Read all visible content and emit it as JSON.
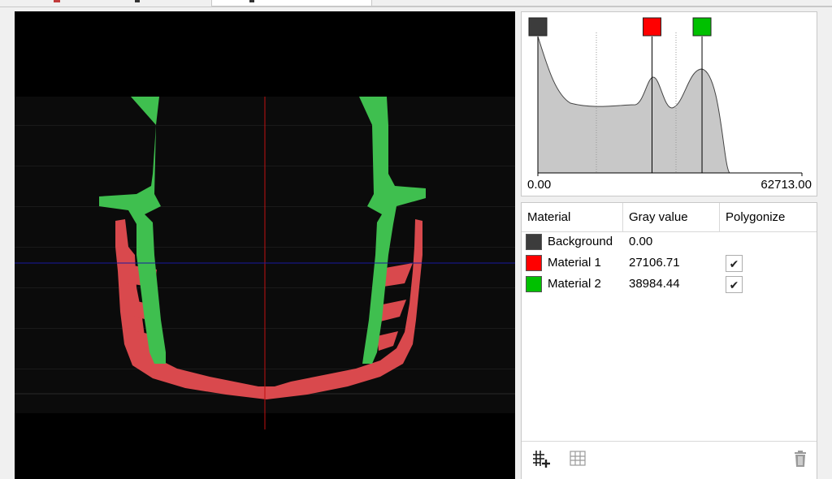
{
  "histogram": {
    "min_label": "0.00",
    "max_label": "62713.00",
    "markers": [
      {
        "name": "Background",
        "color": "#3c3c3c",
        "value": 0.0
      },
      {
        "name": "Material 1",
        "color": "#ff0000",
        "value": 27106.71
      },
      {
        "name": "Material 2",
        "color": "#00c000",
        "value": 38984.44
      }
    ]
  },
  "table": {
    "headers": {
      "material": "Material",
      "gray_value": "Gray value",
      "polygonize": "Polygonize"
    },
    "rows": [
      {
        "name": "Background",
        "gray_value": "0.00",
        "color": "#3c3c3c",
        "polygonize": null
      },
      {
        "name": "Material 1",
        "gray_value": "27106.71",
        "color": "#ff0000",
        "polygonize": "✔"
      },
      {
        "name": "Material 2",
        "gray_value": "38984.44",
        "color": "#00c000",
        "polygonize": "✔"
      }
    ]
  },
  "footer": {
    "icons": [
      "add-material-icon",
      "grid-icon",
      "trash-icon"
    ]
  }
}
